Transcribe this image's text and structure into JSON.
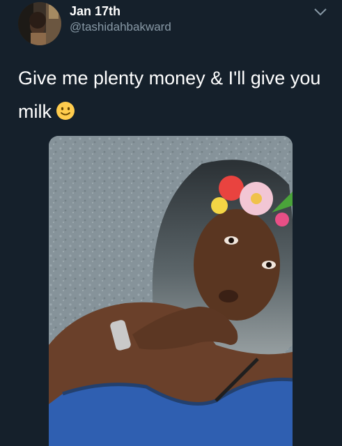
{
  "tweet": {
    "date": "Jan 17th",
    "handle": "@tashidahbakward",
    "text": "Give me plenty money & I'll give you milk",
    "emoji_icon": "slightly-smiling-face-icon",
    "menu_icon": "chevron-down-icon"
  },
  "colors": {
    "background": "#15202b",
    "text_primary": "#ffffff",
    "text_secondary": "#8899a6"
  }
}
